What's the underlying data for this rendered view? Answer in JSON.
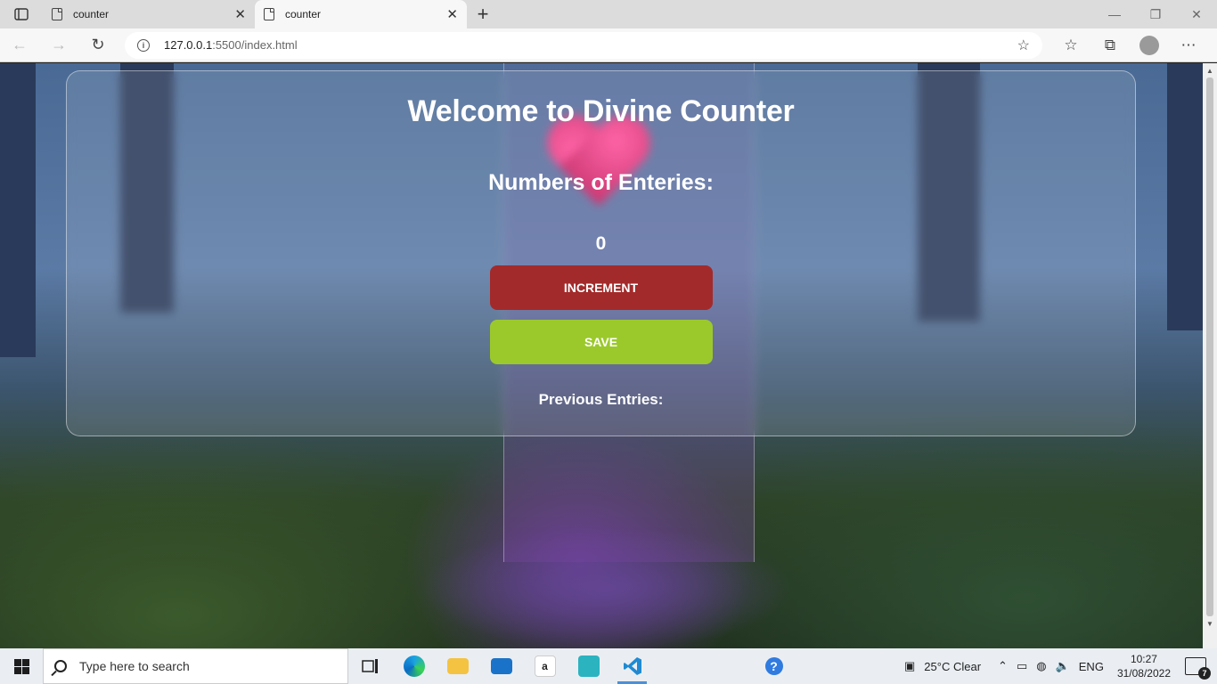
{
  "browser": {
    "tabs": [
      {
        "title": "counter",
        "active": false
      },
      {
        "title": "counter",
        "active": true
      }
    ],
    "new_tab": "+",
    "address": {
      "host": "127.0.0.1",
      "rest": ":5500/index.html"
    }
  },
  "page": {
    "heading": "Welcome to Divine Counter",
    "subheading": "Numbers of Enteries:",
    "count": "0",
    "increment_label": "INCREMENT",
    "save_label": "SAVE",
    "previous_label": "Previous Entries:",
    "colors": {
      "increment": "#a32a2a",
      "save": "#9bc92c"
    }
  },
  "taskbar": {
    "search_placeholder": "Type here to search",
    "weather": "25°C  Clear",
    "language": "ENG",
    "time": "10:27",
    "date": "31/08/2022",
    "notifications": "7"
  }
}
